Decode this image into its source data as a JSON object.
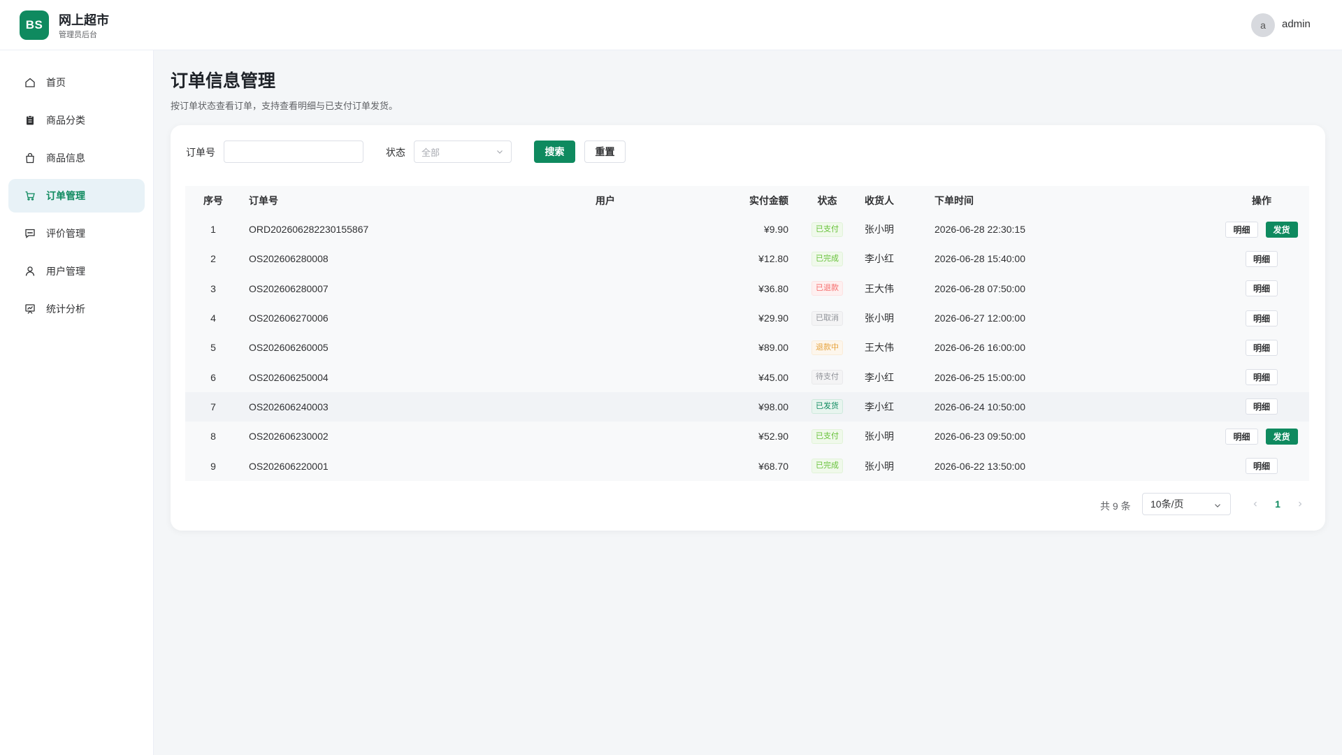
{
  "header": {
    "logo_text": "BS",
    "brand_title": "网上超市",
    "brand_subtitle": "管理员后台",
    "user_avatar_letter": "a",
    "user_name": "admin"
  },
  "sidebar": {
    "items": [
      {
        "label": "首页",
        "icon": "home-icon"
      },
      {
        "label": "商品分类",
        "icon": "clipboard-icon"
      },
      {
        "label": "商品信息",
        "icon": "bag-icon"
      },
      {
        "label": "订单管理",
        "icon": "cart-icon",
        "active": true
      },
      {
        "label": "评价管理",
        "icon": "comment-icon"
      },
      {
        "label": "用户管理",
        "icon": "user-icon"
      },
      {
        "label": "统计分析",
        "icon": "chart-board-icon"
      }
    ]
  },
  "page": {
    "title": "订单信息管理",
    "description": "按订单状态查看订单，支持查看明细与已支付订单发货。"
  },
  "filters": {
    "order_no_label": "订单号",
    "order_no_value": "",
    "status_label": "状态",
    "status_value": "全部",
    "search_label": "搜索",
    "reset_label": "重置"
  },
  "table": {
    "columns": [
      "序号",
      "订单号",
      "用户",
      "实付金额",
      "状态",
      "收货人",
      "下单时间",
      "操作"
    ],
    "rows": [
      {
        "idx": "1",
        "order_no": "ORD202606282230155867",
        "user": "",
        "amount": "¥9.90",
        "status": "已支付",
        "status_kind": "paid",
        "receiver": "张小明",
        "time": "2026-06-28 22:30:15",
        "can_ship": true
      },
      {
        "idx": "2",
        "order_no": "OS202606280008",
        "user": "",
        "amount": "¥12.80",
        "status": "已完成",
        "status_kind": "done",
        "receiver": "李小红",
        "time": "2026-06-28 15:40:00",
        "can_ship": false
      },
      {
        "idx": "3",
        "order_no": "OS202606280007",
        "user": "",
        "amount": "¥36.80",
        "status": "已退款",
        "status_kind": "refund",
        "receiver": "王大伟",
        "time": "2026-06-28 07:50:00",
        "can_ship": false
      },
      {
        "idx": "4",
        "order_no": "OS202606270006",
        "user": "",
        "amount": "¥29.90",
        "status": "已取消",
        "status_kind": "cancel",
        "receiver": "张小明",
        "time": "2026-06-27 12:00:00",
        "can_ship": false
      },
      {
        "idx": "5",
        "order_no": "OS202606260005",
        "user": "",
        "amount": "¥89.00",
        "status": "退款中",
        "status_kind": "refunding",
        "receiver": "王大伟",
        "time": "2026-06-26 16:00:00",
        "can_ship": false
      },
      {
        "idx": "6",
        "order_no": "OS202606250004",
        "user": "",
        "amount": "¥45.00",
        "status": "待支付",
        "status_kind": "pending",
        "receiver": "李小红",
        "time": "2026-06-25 15:00:00",
        "can_ship": false
      },
      {
        "idx": "7",
        "order_no": "OS202606240003",
        "user": "",
        "amount": "¥98.00",
        "status": "已发货",
        "status_kind": "shipped",
        "receiver": "李小红",
        "time": "2026-06-24 10:50:00",
        "can_ship": false
      },
      {
        "idx": "8",
        "order_no": "OS202606230002",
        "user": "",
        "amount": "¥52.90",
        "status": "已支付",
        "status_kind": "paid",
        "receiver": "张小明",
        "time": "2026-06-23 09:50:00",
        "can_ship": true
      },
      {
        "idx": "9",
        "order_no": "OS202606220001",
        "user": "",
        "amount": "¥68.70",
        "status": "已完成",
        "status_kind": "done",
        "receiver": "张小明",
        "time": "2026-06-22 13:50:00",
        "can_ship": false
      }
    ],
    "detail_label": "明细",
    "ship_label": "发货"
  },
  "pagination": {
    "total_text": "共 9 条",
    "page_size": "10条/页",
    "current_page": "1"
  },
  "colors": {
    "accent": "#0f8a5f",
    "background": "#f4f6f8"
  }
}
